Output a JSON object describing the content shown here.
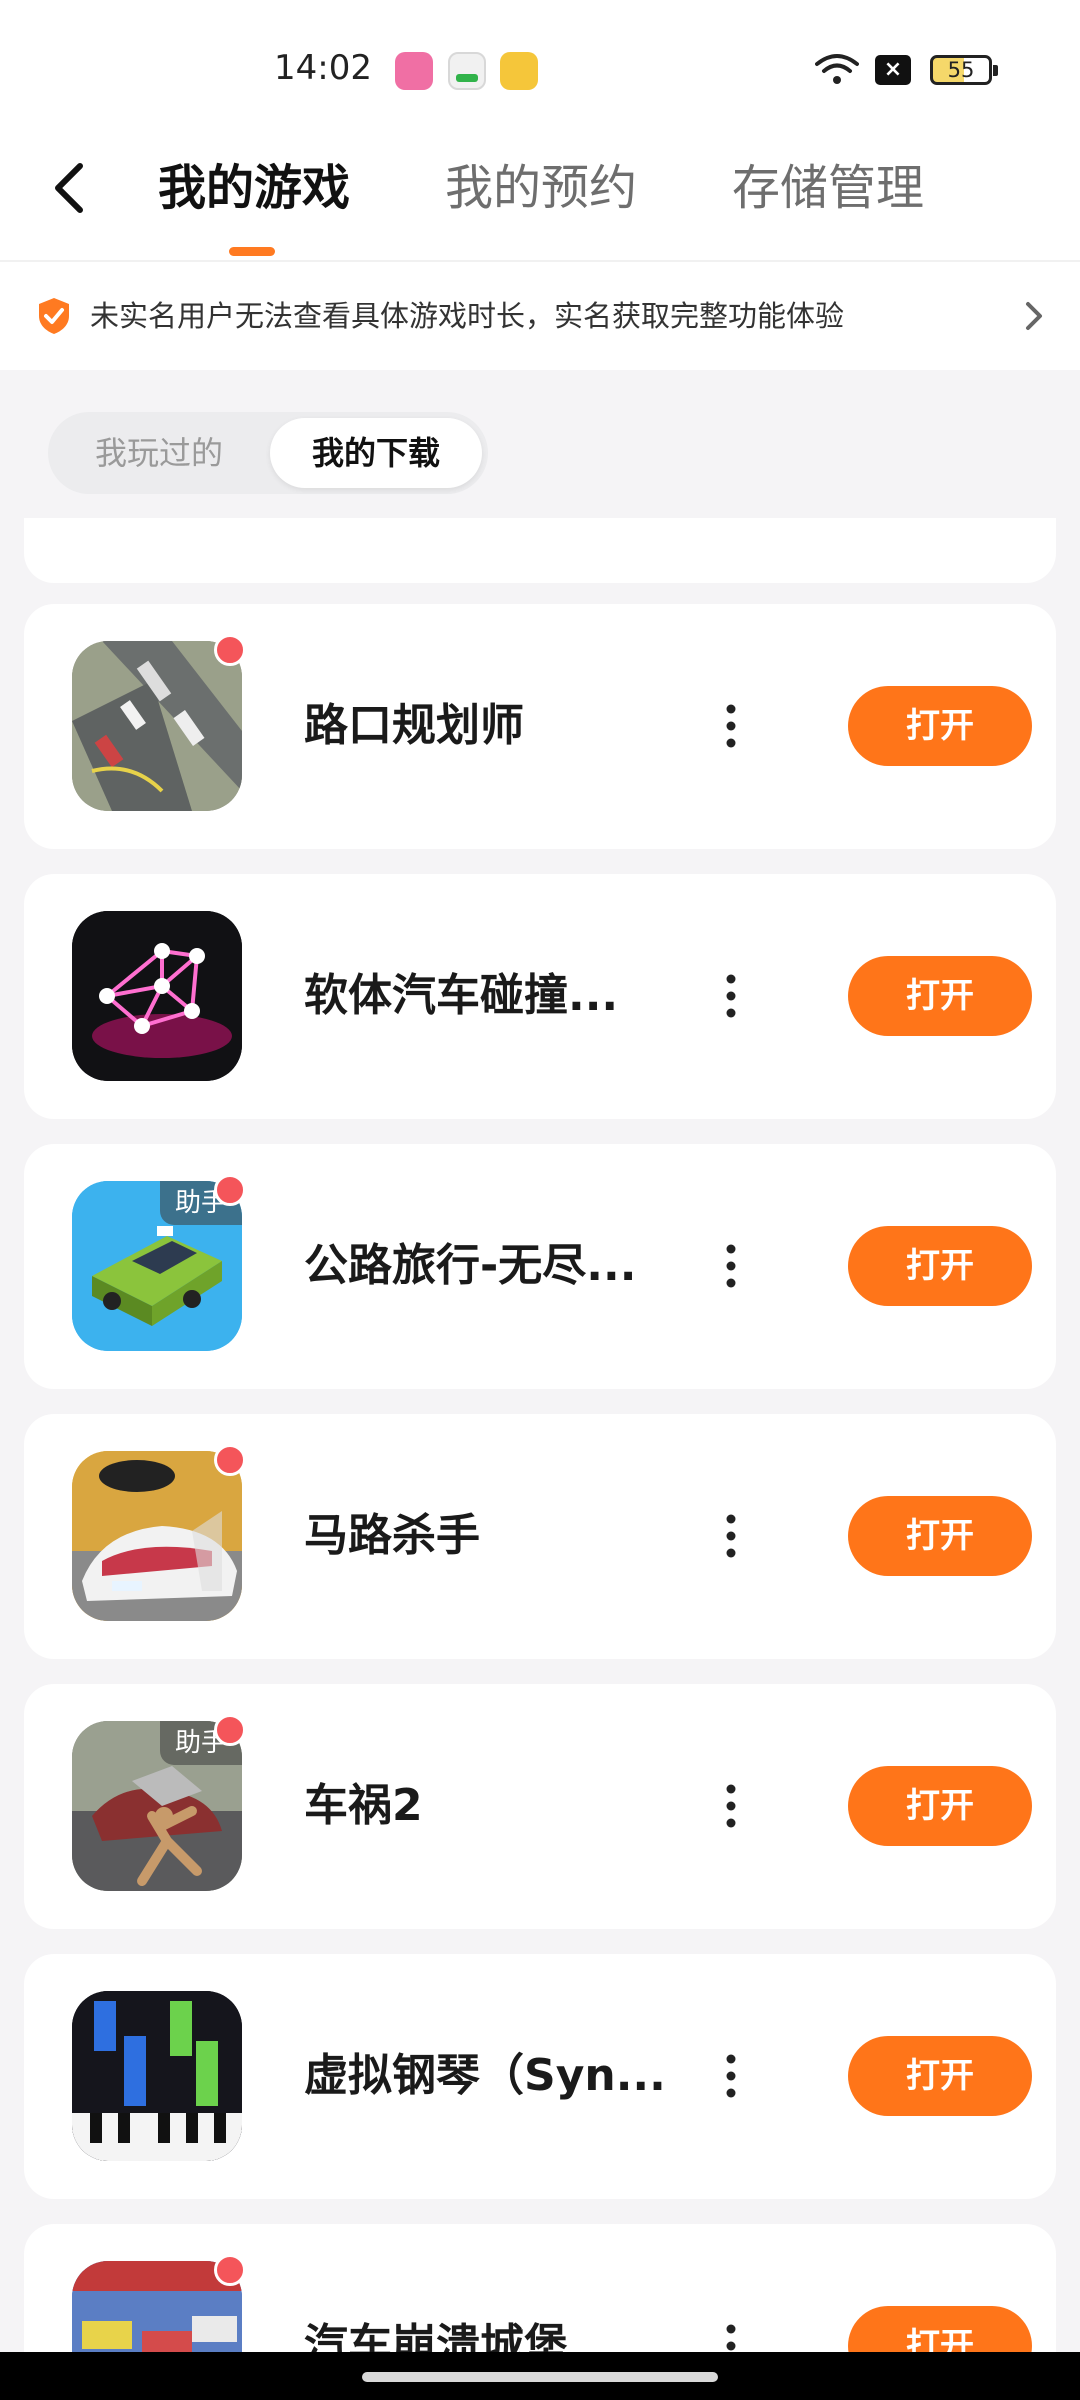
{
  "status_bar": {
    "time": "14:02",
    "battery": "55"
  },
  "header": {
    "tabs": [
      {
        "label": "我的游戏",
        "active": true
      },
      {
        "label": "我的预约",
        "active": false
      },
      {
        "label": "存储管理",
        "active": false
      }
    ]
  },
  "notice": {
    "text": "未实名用户无法查看具体游戏时长，实名获取完整功能体验"
  },
  "segmented": {
    "options": [
      "我玩过的",
      "我的下载"
    ],
    "selected": "我的下载"
  },
  "games": [
    {
      "name": "路口规划师",
      "open_label": "打开",
      "helper": ""
    },
    {
      "name": "软体汽车碰撞...",
      "open_label": "打开",
      "helper": ""
    },
    {
      "name": "公路旅行-无尽...",
      "open_label": "打开",
      "helper": "助手"
    },
    {
      "name": "马路杀手",
      "open_label": "打开",
      "helper": ""
    },
    {
      "name": "车祸2",
      "open_label": "打开",
      "helper": "助手"
    },
    {
      "name": "虚拟钢琴（Syn...",
      "open_label": "打开",
      "helper": ""
    },
    {
      "name": "汽车崩溃城堡",
      "open_label": "打开",
      "helper": ""
    }
  ],
  "colors": {
    "accent": "#ff7519",
    "badge": "#f4555a",
    "tab_indicator": "#ff7a21"
  },
  "icons": [
    "back-icon",
    "shield-check-icon",
    "chevron-right-icon",
    "more-vertical-icon",
    "wifi-icon",
    "battery-icon"
  ]
}
